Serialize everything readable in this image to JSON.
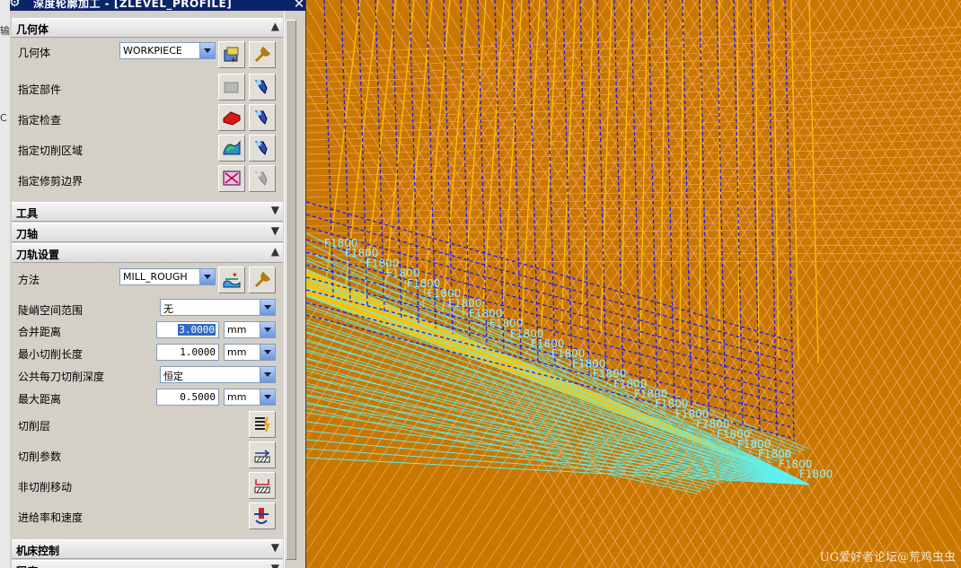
{
  "dialog": {
    "title": "深度轮廓加工 - [ZLEVEL_PROFILE]"
  },
  "left_strip": {
    "fragments": [
      "输",
      "C"
    ]
  },
  "sections": {
    "geometry": "几何体",
    "tool": "工具",
    "axis": "刀轴",
    "path_settings": "刀轨设置",
    "machine_control": "机床控制",
    "program": "程序"
  },
  "geometry": {
    "geometry_label": "几何体",
    "geometry_value": "WORKPIECE",
    "specify_part": "指定部件",
    "specify_check": "指定检查",
    "specify_cut_area": "指定切削区域",
    "specify_trim": "指定修剪边界"
  },
  "path": {
    "method_label": "方法",
    "method_value": "MILL_ROUGH",
    "steep_label": "陡峭空间范围",
    "steep_value": "无",
    "merge_label": "合并距离",
    "merge_value": "3.0000",
    "merge_unit": "mm",
    "minlen_label": "最小切削长度",
    "minlen_value": "1.0000",
    "minlen_unit": "mm",
    "depth_label": "公共每刀切削深度",
    "depth_value": "恒定",
    "maxdist_label": "最大距离",
    "maxdist_value": "0.5000",
    "maxdist_unit": "mm",
    "cut_levels": "切削层",
    "cut_params": "切削参数",
    "non_cut": "非切削移动",
    "feeds": "进给率和速度"
  },
  "viewport": {
    "feed_labels": [
      "F1800",
      "F1800",
      "F1800",
      "F1800",
      "F1800",
      "F1800",
      "F1800",
      "F1800",
      "F1800",
      "F1800",
      "F1800",
      "F1800",
      "F1800",
      "F1800",
      "F1800",
      "F1800",
      "F1800",
      "F1800",
      "F1800",
      "F1800",
      "F1800",
      "F1800",
      "F1800",
      "F1800"
    ],
    "watermark": "UG爱好者论坛@荒鸡虫虫",
    "colors": {
      "background": "#c87800",
      "wire": "#f5a35a",
      "toolpath": "#3333ff",
      "rapid": "#5ef0f0",
      "curve": "#ffc000",
      "label": "#8ff0ff"
    }
  }
}
